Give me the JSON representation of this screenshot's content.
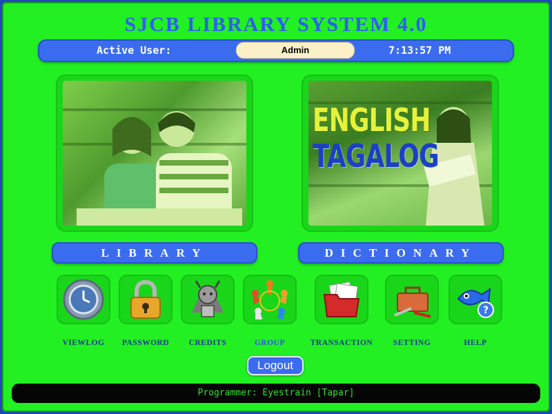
{
  "app": {
    "title": "SJCB LIBRARY SYSTEM 4.0"
  },
  "status": {
    "active_user_label": "Active User:",
    "active_user": "Admin",
    "time": "7:13:57 PM"
  },
  "panels": {
    "library_label": "LIBRARY",
    "dictionary_label": "DICTIONARY",
    "dictionary_image_text": [
      "ENGLISH",
      "TAGALOG"
    ]
  },
  "tiles": [
    {
      "label": "VIEWLOG",
      "icon": "clock-history-icon"
    },
    {
      "label": "PASSWORD",
      "icon": "padlock-icon"
    },
    {
      "label": "CREDITS",
      "icon": "goat-mascot-icon"
    },
    {
      "label": "GROUP",
      "icon": "people-circle-icon"
    },
    {
      "label": "TRANSACTION",
      "icon": "folder-documents-icon"
    },
    {
      "label": "SETTING",
      "icon": "toolbox-icon"
    },
    {
      "label": "HELP",
      "icon": "fish-help-icon"
    }
  ],
  "logout_label": "Logout",
  "footer": {
    "text": "Programmer: Eyestrain [Tapar]"
  },
  "colors": {
    "background": "#22f022",
    "accent_blue": "#3b6cf0",
    "title_blue": "#2c5ff0",
    "footer_text": "#32e032"
  }
}
